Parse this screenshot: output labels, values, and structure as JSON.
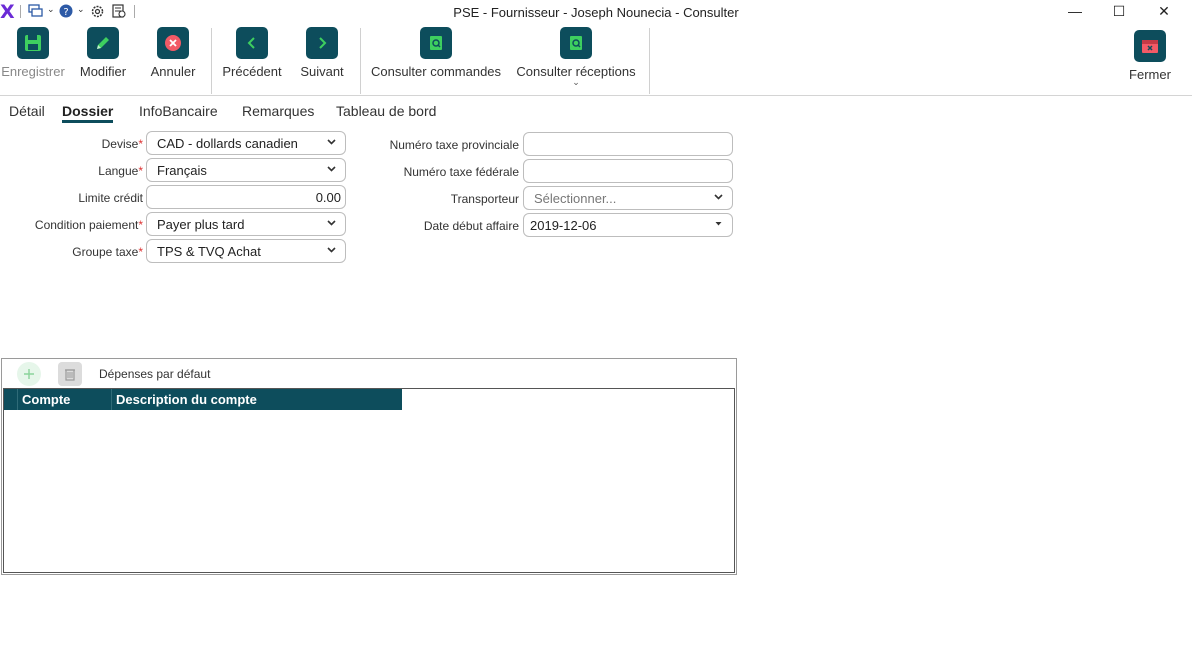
{
  "window": {
    "title": "PSE - Fournisseur - Joseph Nounecia - Consulter",
    "logo": "X",
    "minimize": "—",
    "maximize": "☐",
    "close": "✕"
  },
  "toolbar": {
    "save": "Enregistrer",
    "edit": "Modifier",
    "cancel": "Annuler",
    "previous": "Précédent",
    "next": "Suivant",
    "view_orders": "Consulter commandes",
    "view_receptions": "Consulter réceptions",
    "close": "Fermer"
  },
  "tabs": [
    "Détail",
    "Dossier",
    "InfoBancaire",
    "Remarques",
    "Tableau de bord"
  ],
  "active_tab": "Dossier",
  "form": {
    "devise": {
      "label": "Devise",
      "value": "CAD - dollards canadien"
    },
    "langue": {
      "label": "Langue",
      "value": "Français"
    },
    "limite_credit": {
      "label": "Limite crédit",
      "value": "0.00"
    },
    "condition_paiement": {
      "label": "Condition paiement",
      "value": "Payer plus tard"
    },
    "groupe_taxe": {
      "label": "Groupe taxe",
      "value": "TPS & TVQ Achat"
    },
    "no_taxe_provinciale": {
      "label": "Numéro taxe provinciale",
      "value": ""
    },
    "no_taxe_federale": {
      "label": "Numéro taxe fédérale",
      "value": ""
    },
    "transporteur": {
      "label": "Transporteur",
      "placeholder": "Sélectionner..."
    },
    "date_debut_affaire": {
      "label": "Date début affaire",
      "value": "2019-12-06"
    },
    "required_marker": "*"
  },
  "expenses": {
    "title": "Dépenses par défaut",
    "columns": [
      "Compte",
      "Description du compte"
    ],
    "rows": []
  },
  "colors": {
    "accent": "#0d4d5c",
    "required": "#dd3333",
    "logo": "#6b2bd6"
  },
  "icons": {
    "save": "save-icon",
    "edit": "pencil-icon",
    "cancel": "cancel-icon",
    "previous": "chevron-left-icon",
    "next": "chevron-right-icon",
    "view": "document-search-icon",
    "close": "close-window-icon"
  }
}
